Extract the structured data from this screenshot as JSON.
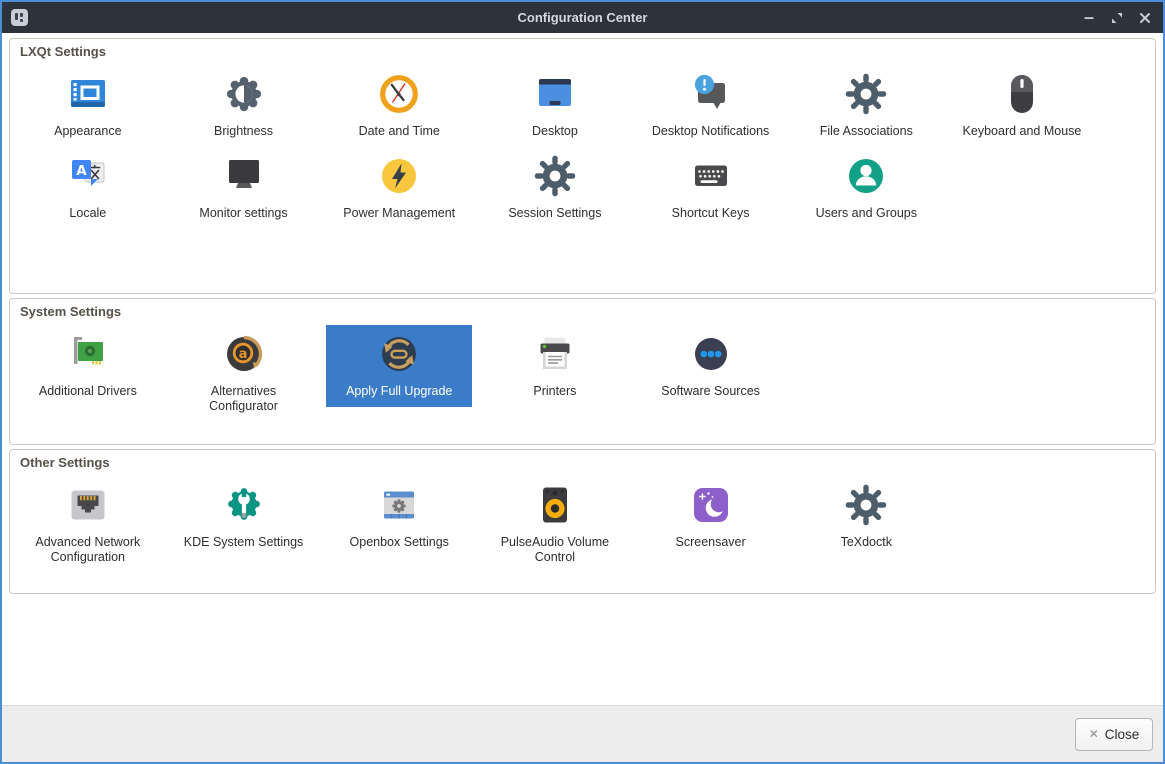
{
  "window": {
    "title": "Configuration Center",
    "controls": {
      "minimize": "–",
      "restore": "restore",
      "close": "✕"
    }
  },
  "colors": {
    "accent_border": "#4a8ed8",
    "titlebar": "#2d323c",
    "selection": "#3b7cc9",
    "section_title": "#56514a",
    "footer_bg": "#ededed"
  },
  "sections": [
    {
      "title": "LXQt Settings",
      "items": [
        {
          "label": "Appearance",
          "icon": "appearance-icon"
        },
        {
          "label": "Brightness",
          "icon": "brightness-icon"
        },
        {
          "label": "Date and Time",
          "icon": "clock-icon"
        },
        {
          "label": "Desktop",
          "icon": "desktop-icon"
        },
        {
          "label": "Desktop Notifications",
          "icon": "notification-bubble-icon"
        },
        {
          "label": "File Associations",
          "icon": "gear-icon"
        },
        {
          "label": "Keyboard and Mouse",
          "icon": "mouse-icon"
        },
        {
          "label": "Locale",
          "icon": "translate-icon"
        },
        {
          "label": "Monitor settings",
          "icon": "monitor-icon"
        },
        {
          "label": "Power Management",
          "icon": "lightning-icon"
        },
        {
          "label": "Session Settings",
          "icon": "gear-icon"
        },
        {
          "label": "Shortcut Keys",
          "icon": "keyboard-icon"
        },
        {
          "label": "Users and Groups",
          "icon": "user-circle-icon"
        }
      ]
    },
    {
      "title": "System Settings",
      "items": [
        {
          "label": "Additional Drivers",
          "icon": "pci-card-icon"
        },
        {
          "label": "Alternatives Configurator",
          "icon": "alternatives-a-icon"
        },
        {
          "label": "Apply Full Upgrade",
          "icon": "upgrade-refresh-icon",
          "selected": true
        },
        {
          "label": "Printers",
          "icon": "printer-icon"
        },
        {
          "label": "Software Sources",
          "icon": "three-dots-icon"
        }
      ]
    },
    {
      "title": "Other Settings",
      "items": [
        {
          "label": "Advanced Network Configuration",
          "icon": "ethernet-port-icon"
        },
        {
          "label": "KDE System Settings",
          "icon": "gear-wrench-icon"
        },
        {
          "label": "Openbox Settings",
          "icon": "window-gear-icon"
        },
        {
          "label": "PulseAudio Volume Control",
          "icon": "speaker-icon"
        },
        {
          "label": "Screensaver",
          "icon": "moon-stars-icon"
        },
        {
          "label": "TeXdoctk",
          "icon": "gear-icon"
        }
      ]
    }
  ],
  "footer": {
    "close_label": "Close",
    "close_glyph": "✕"
  }
}
